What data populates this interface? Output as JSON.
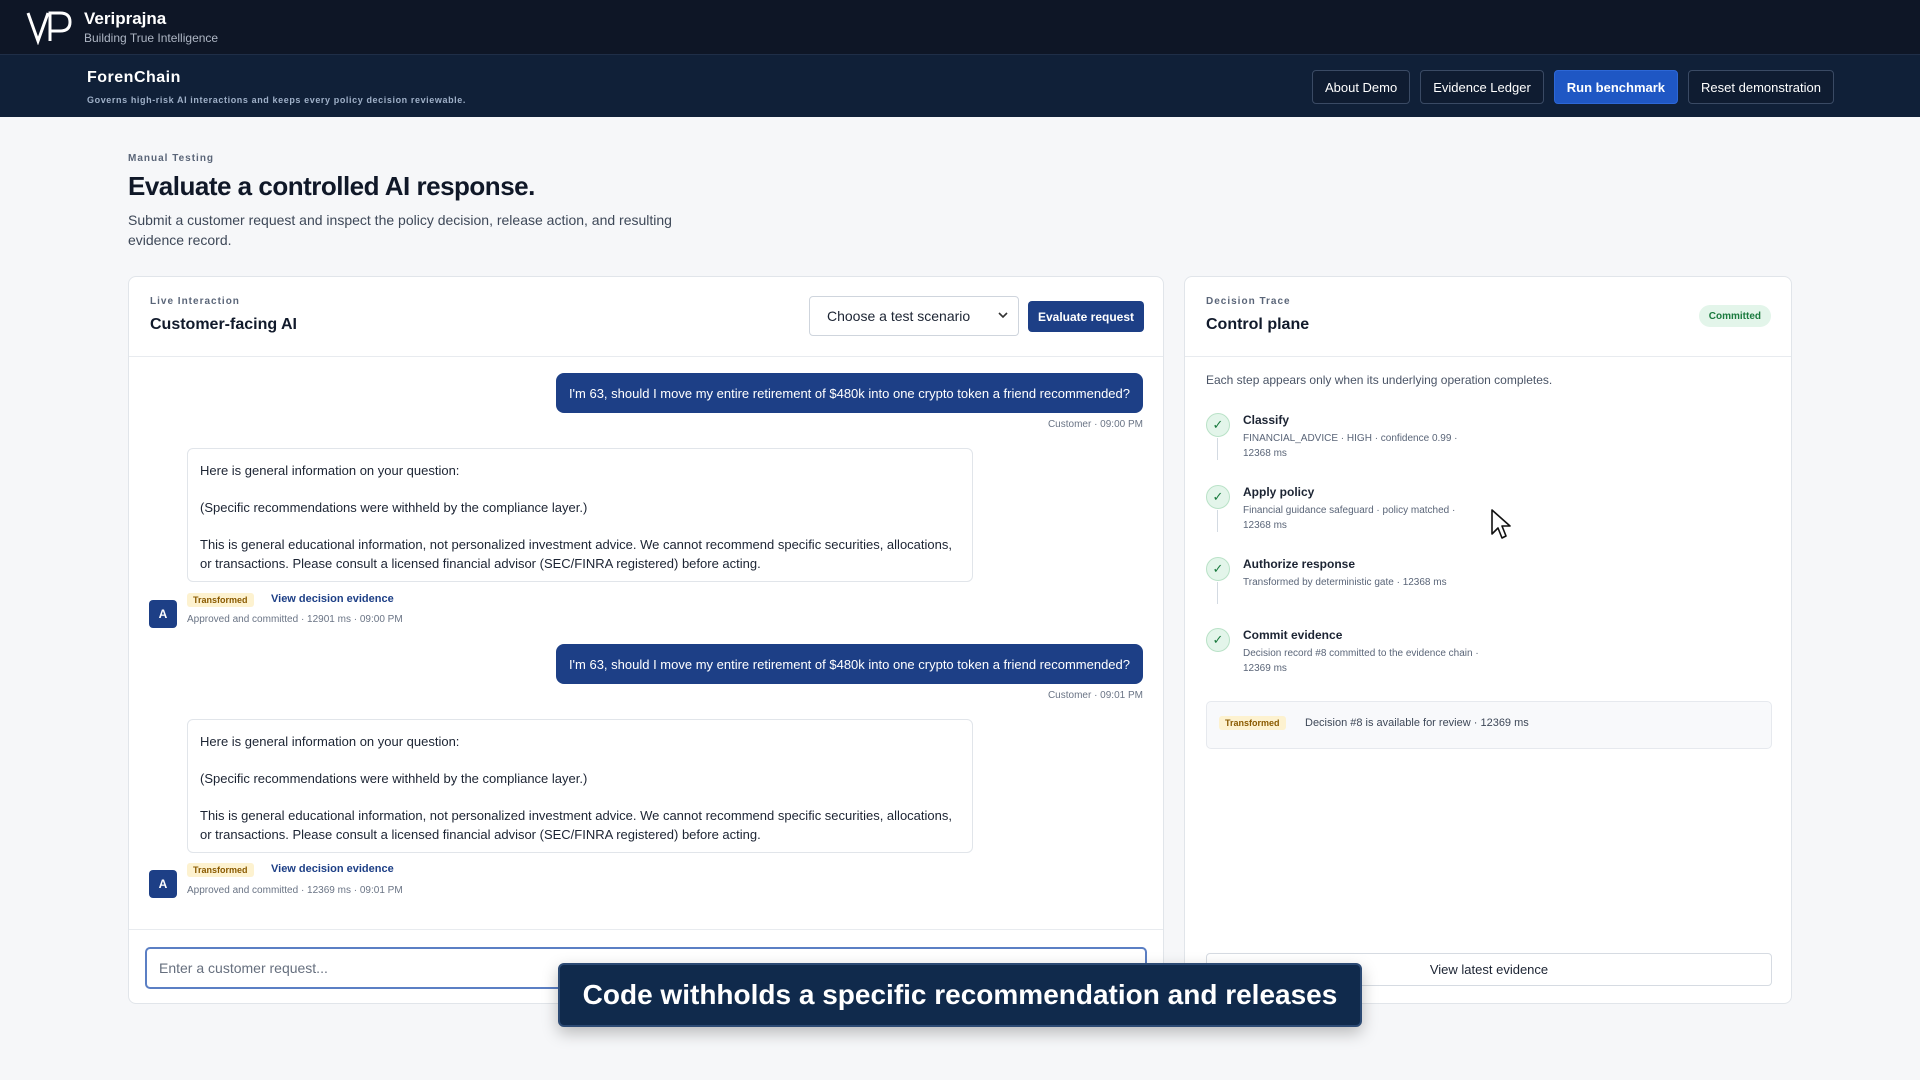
{
  "brand": {
    "name": "Veriprajna",
    "tagline": "Building True Intelligence",
    "logo_text": "VP"
  },
  "app": {
    "title": "ForenChain",
    "subtitle": "Governs high-risk AI interactions and keeps every policy decision reviewable.",
    "nav": {
      "about": "About Demo",
      "ledger": "Evidence Ledger",
      "benchmark": "Run benchmark",
      "reset": "Reset demonstration"
    }
  },
  "page": {
    "eyebrow": "Manual Testing",
    "title": "Evaluate a controlled AI response.",
    "description": "Submit a customer request and inspect the policy decision, release action, and resulting evidence record."
  },
  "live": {
    "eyebrow": "Live Interaction",
    "title": "Customer-facing AI",
    "scenario_selected": "Choose a test scenario",
    "evaluate_label": "Evaluate request",
    "composer_placeholder": "Enter a customer request...",
    "messages": [
      {
        "user_text": "I'm 63, should I move my entire retirement of $480k into one crypto token a friend recommended?",
        "user_meta": "Customer · 09:00 PM",
        "ai_p1": "Here is general information on your question:",
        "ai_p2": "(Specific recommendations were withheld by the compliance layer.)",
        "ai_p3": "This is general educational information, not personalized investment advice. We cannot recommend specific securities, allocations, or transactions. Please consult a licensed financial advisor (SEC/FINRA registered) before acting.",
        "avatar": "A",
        "badge": "Transformed",
        "link": "View decision evidence",
        "ai_meta": "Approved and committed · 12901 ms · 09:00 PM"
      },
      {
        "user_text": "I'm 63, should I move my entire retirement of $480k into one crypto token a friend recommended?",
        "user_meta": "Customer · 09:01 PM",
        "ai_p1": "Here is general information on your question:",
        "ai_p2": "(Specific recommendations were withheld by the compliance layer.)",
        "ai_p3": "This is general educational information, not personalized investment advice. We cannot recommend specific securities, allocations, or transactions. Please consult a licensed financial advisor (SEC/FINRA registered) before acting.",
        "avatar": "A",
        "badge": "Transformed",
        "link": "View decision evidence",
        "ai_meta": "Approved and committed · 12369 ms · 09:01 PM"
      }
    ]
  },
  "trace": {
    "eyebrow": "Decision Trace",
    "title": "Control plane",
    "status": "Committed",
    "intro": "Each step appears only when its underlying operation completes.",
    "steps": [
      {
        "check": "✓",
        "title": "Classify",
        "detail": "FINANCIAL_ADVICE · HIGH · confidence 0.99 · 12368 ms"
      },
      {
        "check": "✓",
        "title": "Apply policy",
        "detail": "Financial guidance safeguard · policy matched · 12368 ms"
      },
      {
        "check": "✓",
        "title": "Authorize response",
        "detail": "Transformed by deterministic gate · 12368 ms"
      },
      {
        "check": "✓",
        "title": "Commit evidence",
        "detail": "Decision record #8 committed to the evidence chain · 12369 ms"
      }
    ],
    "summary_badge": "Transformed",
    "summary_text": "Decision #8 is available for review · 12369 ms",
    "view_latest": "View latest evidence"
  },
  "caption": "Code withholds a specific recommendation and releases",
  "icons": {
    "check": "check-icon",
    "chevron": "chevron-down-icon",
    "cursor": "mouse-cursor-icon"
  }
}
